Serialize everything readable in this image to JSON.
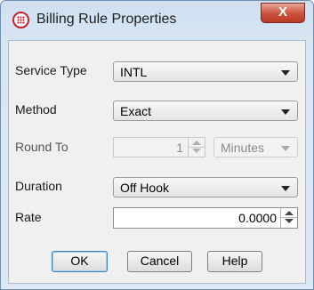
{
  "window": {
    "title": "Billing Rule Properties",
    "close_label": "X"
  },
  "form": {
    "service_type": {
      "label": "Service Type",
      "value": "INTL"
    },
    "method": {
      "label": "Method",
      "value": "Exact"
    },
    "round_to": {
      "label": "Round To",
      "value": "1",
      "unit": "Minutes",
      "enabled": false
    },
    "duration": {
      "label": "Duration",
      "value": "Off Hook"
    },
    "rate": {
      "label": "Rate",
      "value": "0.0000"
    }
  },
  "buttons": {
    "ok": "OK",
    "cancel": "Cancel",
    "help": "Help"
  },
  "colors": {
    "accent": "#c8202c",
    "close": "#c9513b"
  }
}
